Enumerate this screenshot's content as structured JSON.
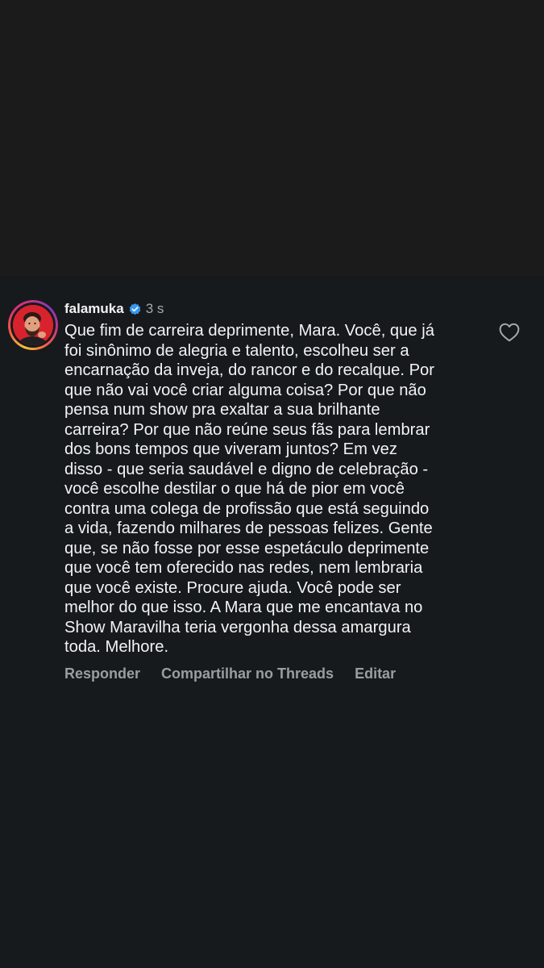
{
  "comment": {
    "username": "falamuka",
    "verified": true,
    "timestamp": "3 s",
    "text": "Que fim de carreira deprimente, Mara. Você, que já\nfoi sinônimo de alegria e talento, escolheu ser a\nencarnação da inveja, do rancor e do recalque. Por\nque não vai você criar alguma coisa? Por que não\npensa num show pra exaltar a sua brilhante\ncarreira? Por que não reúne seus fãs para lembrar\ndos bons tempos que viveram juntos? Em vez\ndisso - que seria saudável e digno de celebração -\nvocê escolhe destilar o que há de pior em você\ncontra uma colega de profissão que está seguindo\na vida, fazendo milhares de pessoas felizes. Gente\nque, se não fosse por esse espetáculo deprimente\nque você tem oferecido nas redes, nem lembraria\nque você existe. Procure ajuda. Você pode ser\nmelhor do que isso. A Mara que me encantava no\nShow Maravilha teria vergonha dessa amargura\ntoda. Melhore.",
    "actions": {
      "reply": "Responder",
      "share_threads": "Compartilhar no Threads",
      "edit": "Editar"
    }
  },
  "icons": {
    "verified": "verified-badge-icon",
    "like": "heart-outline-icon"
  },
  "colors": {
    "background_top": "#1b1b1c",
    "background_panel": "#161a1d",
    "text_primary": "#f3f3f3",
    "text_secondary": "#9a9ea3",
    "verified_blue": "#3897f0",
    "avatar_red": "#d8232f"
  }
}
